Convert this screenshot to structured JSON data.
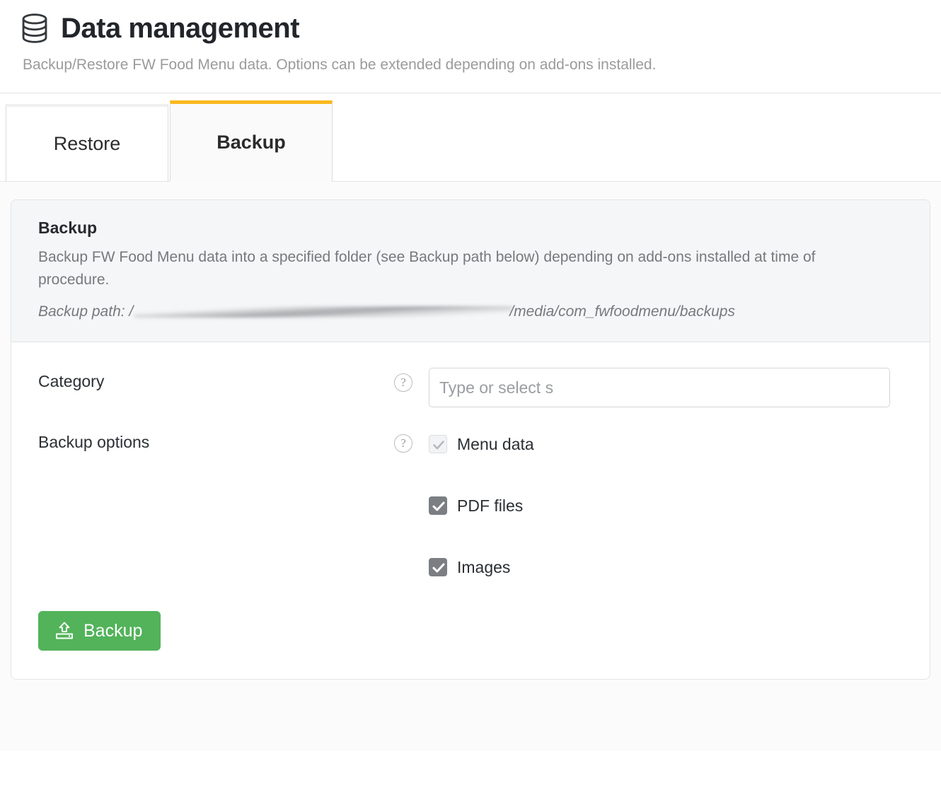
{
  "header": {
    "icon": "database-icon",
    "title": "Data management",
    "subtitle": "Backup/Restore FW Food Menu data. Options can be extended depending on add-ons installed."
  },
  "tabs": {
    "active_accent_color": "#fbb91f",
    "items": [
      {
        "label": "Restore",
        "active": false
      },
      {
        "label": "Backup",
        "active": true
      }
    ]
  },
  "card": {
    "heading": "Backup",
    "description": "Backup FW Food Menu data into a specified folder (see Backup path below) depending on add-ons installed at time of procedure.",
    "path_label": "Backup path:",
    "path_prefix": "/",
    "path_redacted": true,
    "path_suffix": "/media/com_fwfoodmenu/backups"
  },
  "form": {
    "category": {
      "label": "Category",
      "help_icon": "question-circle-icon",
      "placeholder": "Type or select s",
      "value": ""
    },
    "backup_options": {
      "label": "Backup options",
      "help_icon": "question-circle-icon",
      "options": [
        {
          "label": "Menu data",
          "checked": true,
          "disabled": true
        },
        {
          "label": "PDF files",
          "checked": true,
          "disabled": false
        },
        {
          "label": "Images",
          "checked": true,
          "disabled": false
        }
      ]
    },
    "submit": {
      "label": "Backup",
      "icon": "upload-drive-icon",
      "color": "#52b35a"
    }
  }
}
